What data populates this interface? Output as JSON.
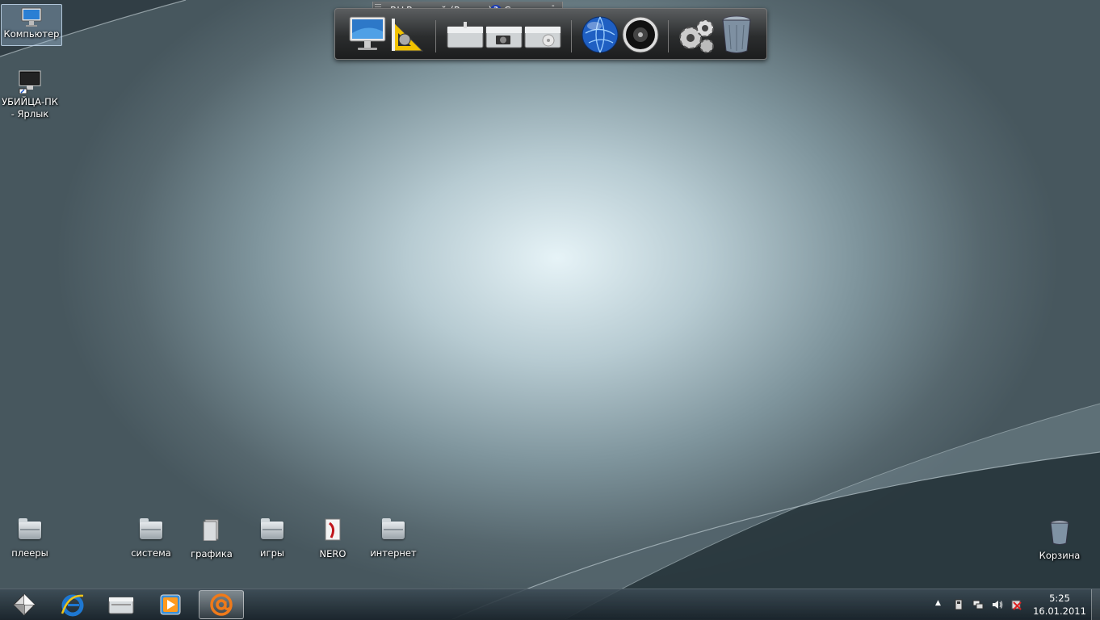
{
  "desktop": {
    "icons_top": [
      {
        "label": "Компьютер",
        "selected": true
      },
      {
        "label": "УБИЙЦА-ПК - Ярлык"
      }
    ],
    "icons_bottom": [
      {
        "label": "плееры"
      },
      {
        "label": "система"
      },
      {
        "label": "графика"
      },
      {
        "label": "игры"
      },
      {
        "label": "NERO"
      },
      {
        "label": "интернет"
      }
    ],
    "recycle_bin": {
      "label": "Корзина"
    }
  },
  "language_bar": {
    "lang_code": "RU",
    "lang_name": "Русский (Россия)",
    "help_label": "Справка"
  },
  "dock": {
    "items": [
      "computer-icon",
      "tools-icon",
      "drive-icon",
      "camera-drive-icon",
      "disc-drive-icon",
      "globe-icon",
      "speaker-icon",
      "settings-gears-icon",
      "trash-icon"
    ]
  },
  "taskbar": {
    "buttons": [
      "start-icon",
      "internet-explorer-icon",
      "folder-icon",
      "media-player-icon",
      "mail-at-icon"
    ],
    "active": "mail-at-icon"
  },
  "tray": {
    "time": "5:25",
    "date": "16.01.2011"
  },
  "colors": {
    "accent_orange": "#f07a1a",
    "ie_blue": "#1e78d2"
  }
}
